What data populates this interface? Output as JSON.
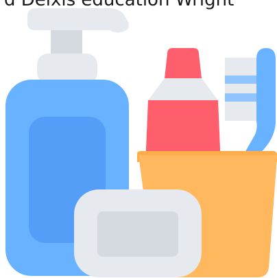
{
  "caption": {
    "text": "d Déixis education Wright"
  },
  "colors": {
    "pump_light": "#e6e9ee",
    "pump_mid": "#d5dae1",
    "bottle_outer": "#69b2ff",
    "bottle_inner": "#559ef8",
    "toothpaste_red": "#ff5f6d",
    "toothpaste_cap": "#e6e9ee",
    "cup_orange": "#ffb85e",
    "cup_rim": "#ffad4a",
    "brush_blue": "#69b2ff",
    "brush_bristles": "#e6e9ee",
    "brush_stripe": "#8fc4ff",
    "soap_outer": "#e6e9ee",
    "soap_inner": "#d5dae1"
  },
  "icons": [
    "soap-dispenser-icon",
    "toothpaste-tube-icon",
    "toothbrush-icon",
    "cup-icon",
    "soap-bar-icon"
  ]
}
